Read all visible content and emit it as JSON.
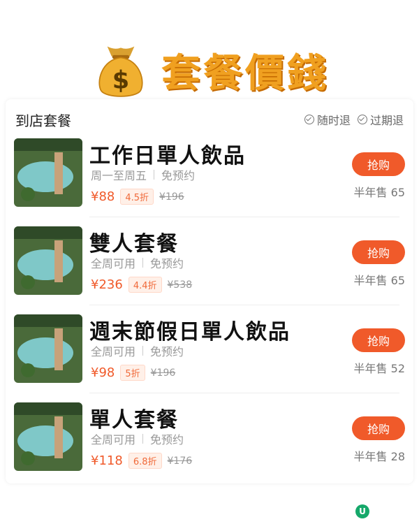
{
  "header": {
    "title": "套餐價錢",
    "icon": "money-bag-icon"
  },
  "section": {
    "title": "到店套餐",
    "policies": [
      "随时退",
      "过期退"
    ]
  },
  "items": [
    {
      "name": "工作日單人飲品",
      "availability": "周一至周五",
      "reservation": "免预约",
      "price": "¥88",
      "discount": "4.5折",
      "original_price": "¥196",
      "buy_label": "抢购",
      "sold": "半年售 65"
    },
    {
      "name": "雙人套餐",
      "availability": "全周可用",
      "reservation": "免预约",
      "price": "¥236",
      "discount": "4.4折",
      "original_price": "¥538",
      "buy_label": "抢购",
      "sold": "半年售 65"
    },
    {
      "name": "週末節假日單人飲品",
      "availability": "全周可用",
      "reservation": "免预约",
      "price": "¥98",
      "discount": "5折",
      "original_price": "¥196",
      "buy_label": "抢购",
      "sold": "半年售 52"
    },
    {
      "name": "單人套餐",
      "availability": "全周可用",
      "reservation": "免预约",
      "price": "¥118",
      "discount": "6.8折",
      "original_price": "¥176",
      "buy_label": "抢购",
      "sold": "半年售 28"
    }
  ],
  "colors": {
    "accent": "#f05a2a",
    "title": "#f0a020"
  }
}
